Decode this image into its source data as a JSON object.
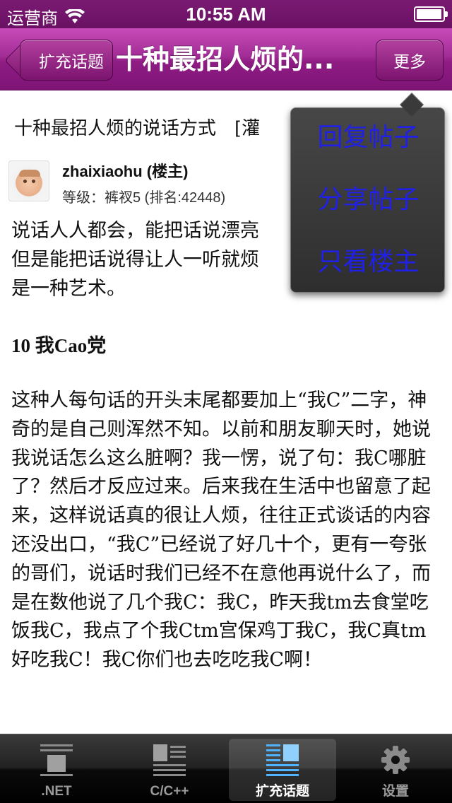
{
  "status_bar": {
    "carrier": "运营商",
    "time": "10:55 AM"
  },
  "nav": {
    "back_label": "扩充话题",
    "title": "十种最招人烦的...",
    "more_label": "更多"
  },
  "post": {
    "title": "十种最招人烦的说话方式　[灌",
    "author": "zhaixiaohu (楼主)",
    "level": "等级：裤衩5 (排名:42448)",
    "paragraph1": "说话人人都会，能把话说漂亮\n但是能把话说得让人一听就烦\n是一种艺术。",
    "heading": "10 我Cao党",
    "paragraph2": "这种人每句话的开头末尾都要加上“我C”二字，神奇的是自己则浑然不知。以前和朋友聊天时，她说我说话怎么这么脏啊？我一愣，说了句：我C哪脏了？然后才反应过来。后来我在生活中也留意了起来，这样说话真的很让人烦，往往正式谈话的内容还没出口，“我C”已经说了好几十个，更有一夸张的哥们，说话时我们已经不在意他再说什么了，而是在数他说了几个我C：我C，昨天我tm去食堂吃饭我C，我点了个我Ctm宫保鸡丁我C，我C真tm好吃我C！我C你们也去吃吃我C啊！"
  },
  "popup_menu": {
    "items": [
      "回复帖子",
      "分享帖子",
      "只看楼主"
    ]
  },
  "tab_bar": {
    "tabs": [
      {
        "label": ".NET",
        "icon": "dotnet-icon",
        "active": false
      },
      {
        "label": "C/C++",
        "icon": "cpp-icon",
        "active": false
      },
      {
        "label": "扩充话题",
        "icon": "topics-icon",
        "active": true
      },
      {
        "label": "设置",
        "icon": "gear-icon",
        "active": false
      }
    ]
  },
  "colors": {
    "nav_purple": "#8e1c83",
    "popup_link": "#2020e6"
  }
}
